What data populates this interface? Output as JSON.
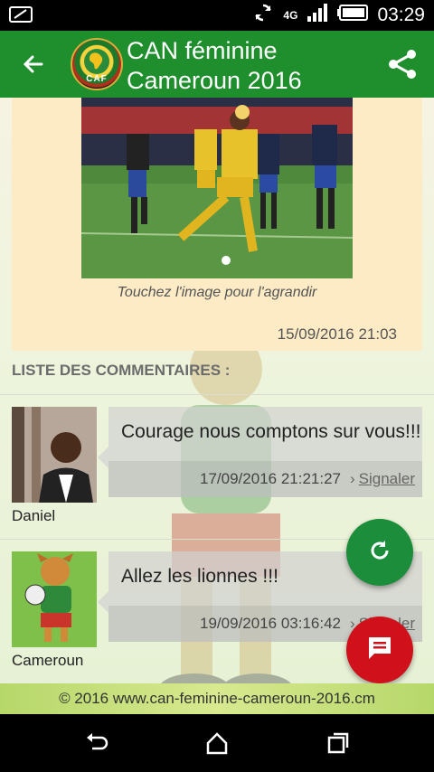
{
  "status": {
    "time": "03:29",
    "network": "4G"
  },
  "appbar": {
    "title": "CAN féminine Cameroun 2016",
    "logo_text": "CAF"
  },
  "article": {
    "caption": "Touchez l'image pour l'agrandir",
    "date": "15/09/2016 21:03"
  },
  "comments_header": "LISTE DES COMMENTAIRES :",
  "comments": [
    {
      "author": "Daniel",
      "text": "Courage nous comptons sur vous!!!",
      "date": "17/09/2016 21:21:27",
      "report_label": "Signaler"
    },
    {
      "author": "Cameroun",
      "text": "Allez les lionnes !!!",
      "date": "19/09/2016 03:16:42",
      "report_label": "Signaler"
    }
  ],
  "footer": "© 2016 www.can-feminine-cameroun-2016.cm",
  "colors": {
    "appbar": "#1f8e2d",
    "fab_refresh": "#1c8d3a",
    "fab_chat": "#d0101b",
    "article_bg": "#fdebc6"
  },
  "icons": {
    "status": [
      "screenshot-icon",
      "sync-icon",
      "signal-icon",
      "battery-icon"
    ],
    "appbar": [
      "back-arrow-icon",
      "share-icon"
    ],
    "fabs": [
      "refresh-icon",
      "chat-icon"
    ],
    "nav": [
      "nav-back-icon",
      "nav-home-icon",
      "nav-recents-icon"
    ]
  }
}
